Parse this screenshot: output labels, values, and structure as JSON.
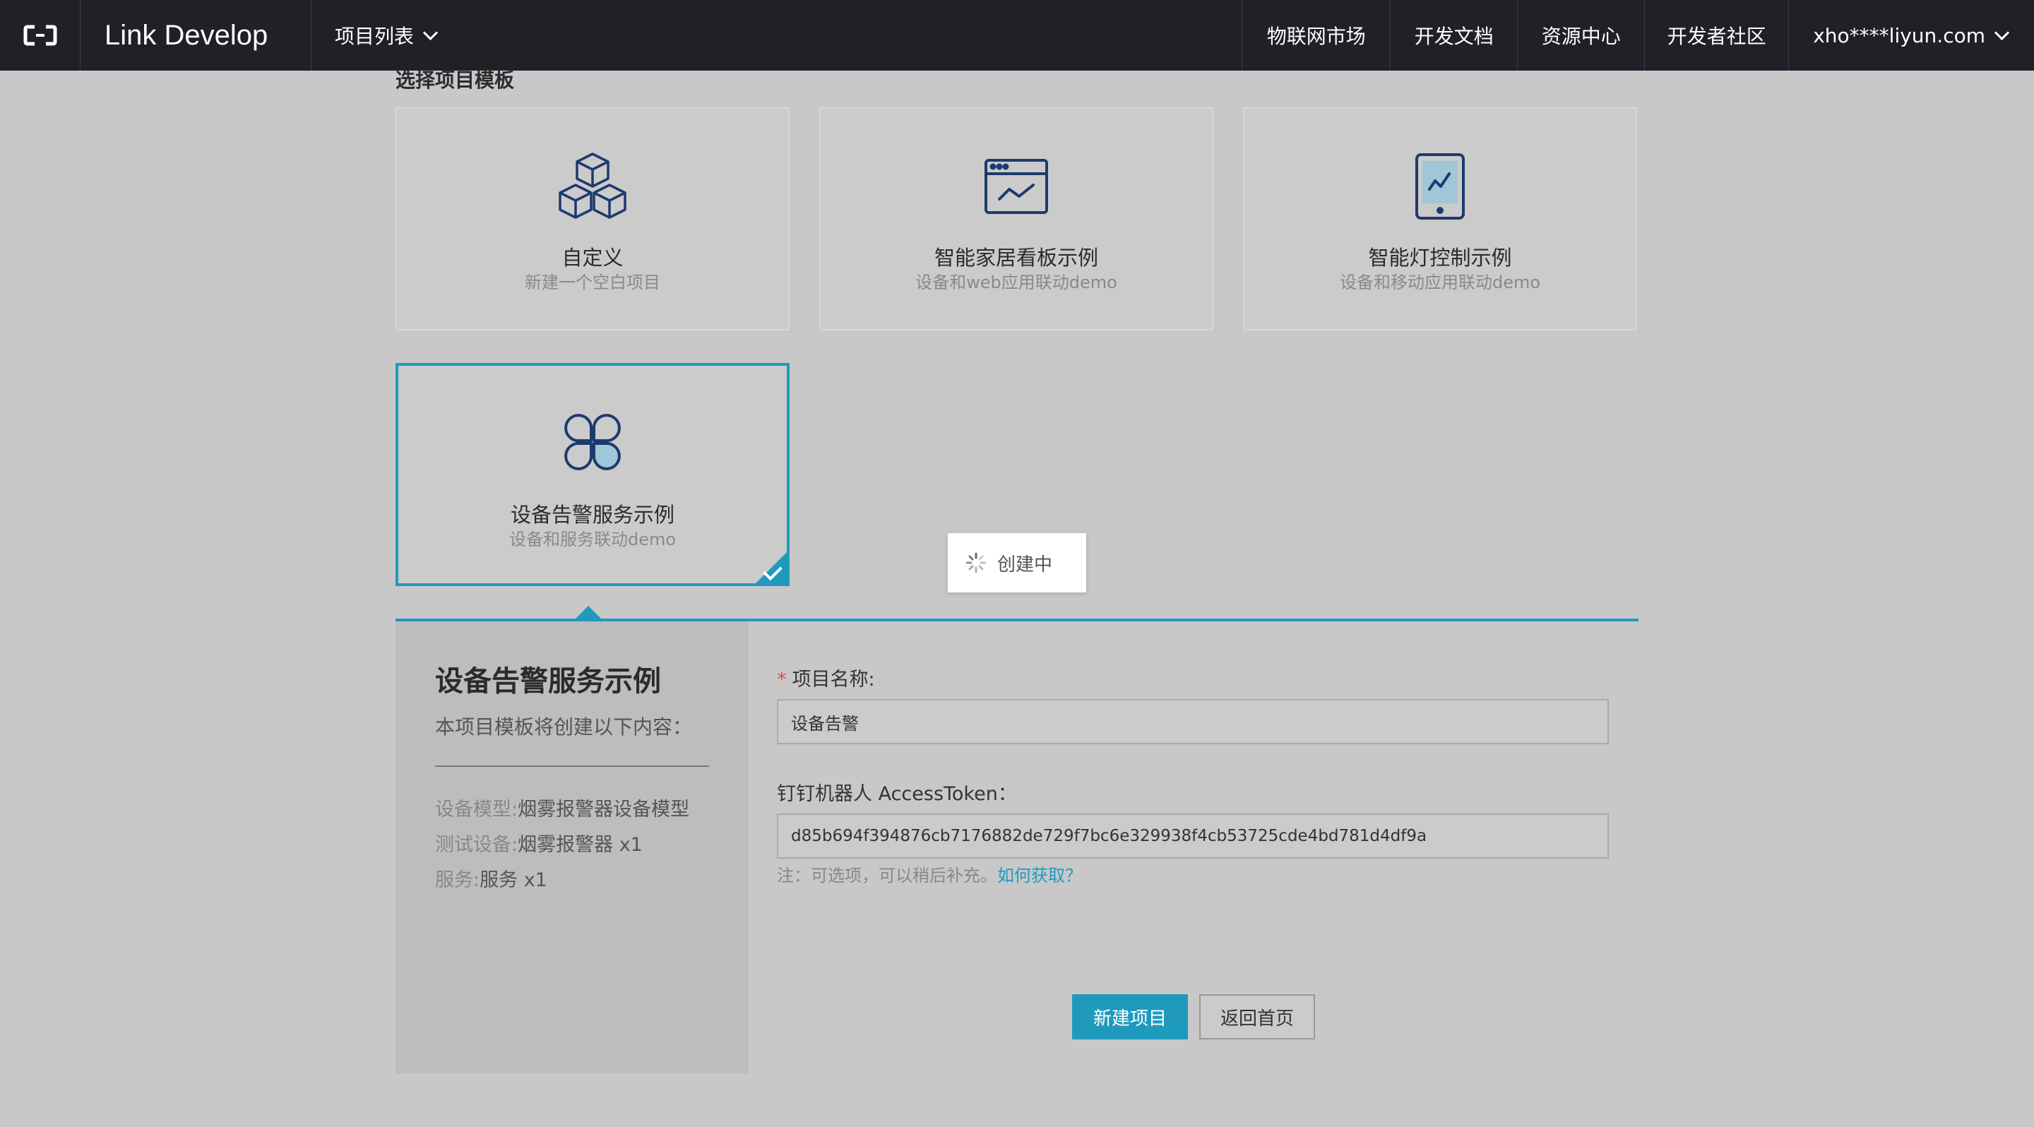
{
  "nav": {
    "brand": "Link Develop",
    "project_menu": "项目列表",
    "links": [
      "物联网市场",
      "开发文档",
      "资源中心",
      "开发者社区"
    ],
    "user": "xho****liyun.com"
  },
  "section_title": "选择项目模板",
  "templates": [
    {
      "name": "自定义",
      "desc": "新建一个空白项目",
      "icon": "cubes-icon"
    },
    {
      "name": "智能家居看板示例",
      "desc": "设备和web应用联动demo",
      "icon": "browser-chart-icon"
    },
    {
      "name": "智能灯控制示例",
      "desc": "设备和移动应用联动demo",
      "icon": "mobile-chart-icon"
    },
    {
      "name": "设备告警服务示例",
      "desc": "设备和服务联动demo",
      "icon": "clover-icon",
      "selected": true
    }
  ],
  "toast": "创建中",
  "detail": {
    "title": "设备告警服务示例",
    "subtitle": "本项目模板将创建以下内容：",
    "items": [
      {
        "label": "设备模型:",
        "value": "烟雾报警器设备模型"
      },
      {
        "label": "测试设备:",
        "value": "烟雾报警器 x1"
      },
      {
        "label": "服务:",
        "value": "服务 x1"
      }
    ]
  },
  "form": {
    "name_label": "项目名称:",
    "name_value": "设备告警",
    "token_label": "钉钉机器人 AccessToken：",
    "token_value": "d85b694f394876cb7176882de729f7bc6e329938f4cb53725cde4bd781d4df9a",
    "hint": "注：可选项，可以稍后补充。",
    "hint_link": "如何获取？",
    "create_button": "新建项目",
    "back_button": "返回首页"
  },
  "colors": {
    "accent": "#1f9abd",
    "topbar": "#1f2126",
    "icon": "#1d3a6e"
  }
}
